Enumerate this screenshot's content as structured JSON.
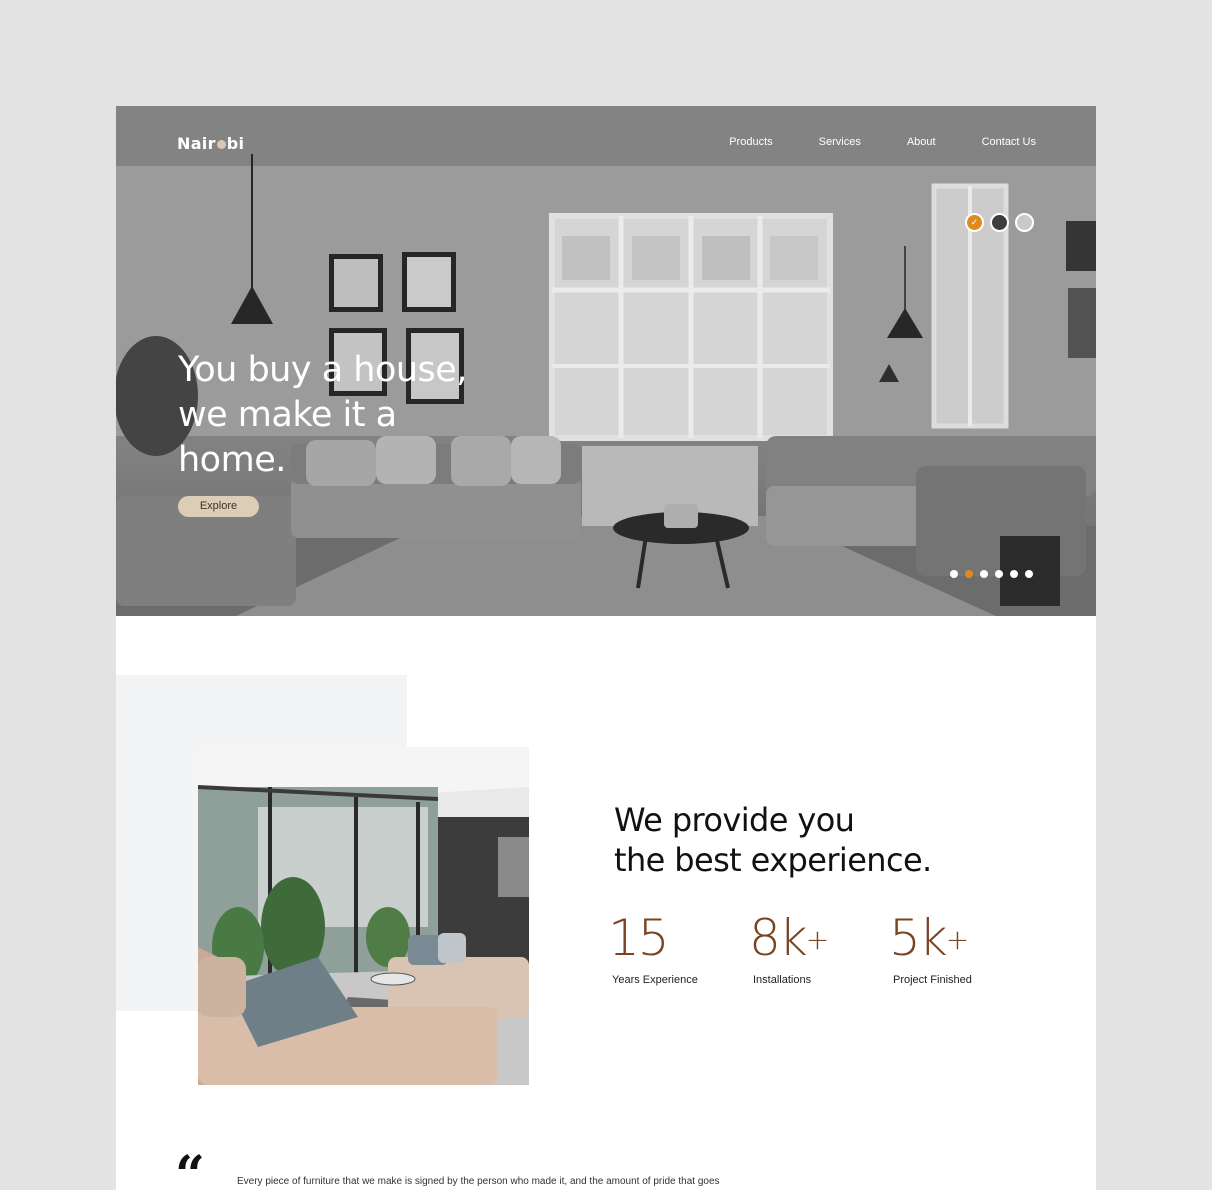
{
  "nav": {
    "logo_start": "Nair",
    "logo_end": "bi",
    "links": [
      "Products",
      "Services",
      "About",
      "Contact Us"
    ]
  },
  "hero": {
    "title_lines": [
      "You buy a house,",
      "we make it a",
      "home."
    ],
    "cta_label": "Explore",
    "swatches": [
      {
        "color": "#e08a1e",
        "selected": true
      },
      {
        "color": "#3d3d3d",
        "selected": false
      },
      {
        "color": "#c9c9c9",
        "selected": false
      }
    ],
    "slides_count": 6,
    "active_slide": 1
  },
  "about": {
    "title_lines": [
      "We provide you",
      "the best experience."
    ],
    "stats": [
      {
        "value": "15",
        "suffix": "",
        "label": "Years Experience"
      },
      {
        "value": "8k",
        "suffix": "+",
        "label": "Installations"
      },
      {
        "value": "5k",
        "suffix": "+",
        "label": "Project Finished"
      }
    ]
  },
  "quote": {
    "mark": "“",
    "text": "Every piece of furniture that we make is signed by the person who made it, and the amount of pride that goes"
  },
  "colors": {
    "accent": "#e08a1e",
    "stat_brown": "#7a4321",
    "button_beige": "#dccdb6",
    "page_bg": "#e3e3e3"
  }
}
